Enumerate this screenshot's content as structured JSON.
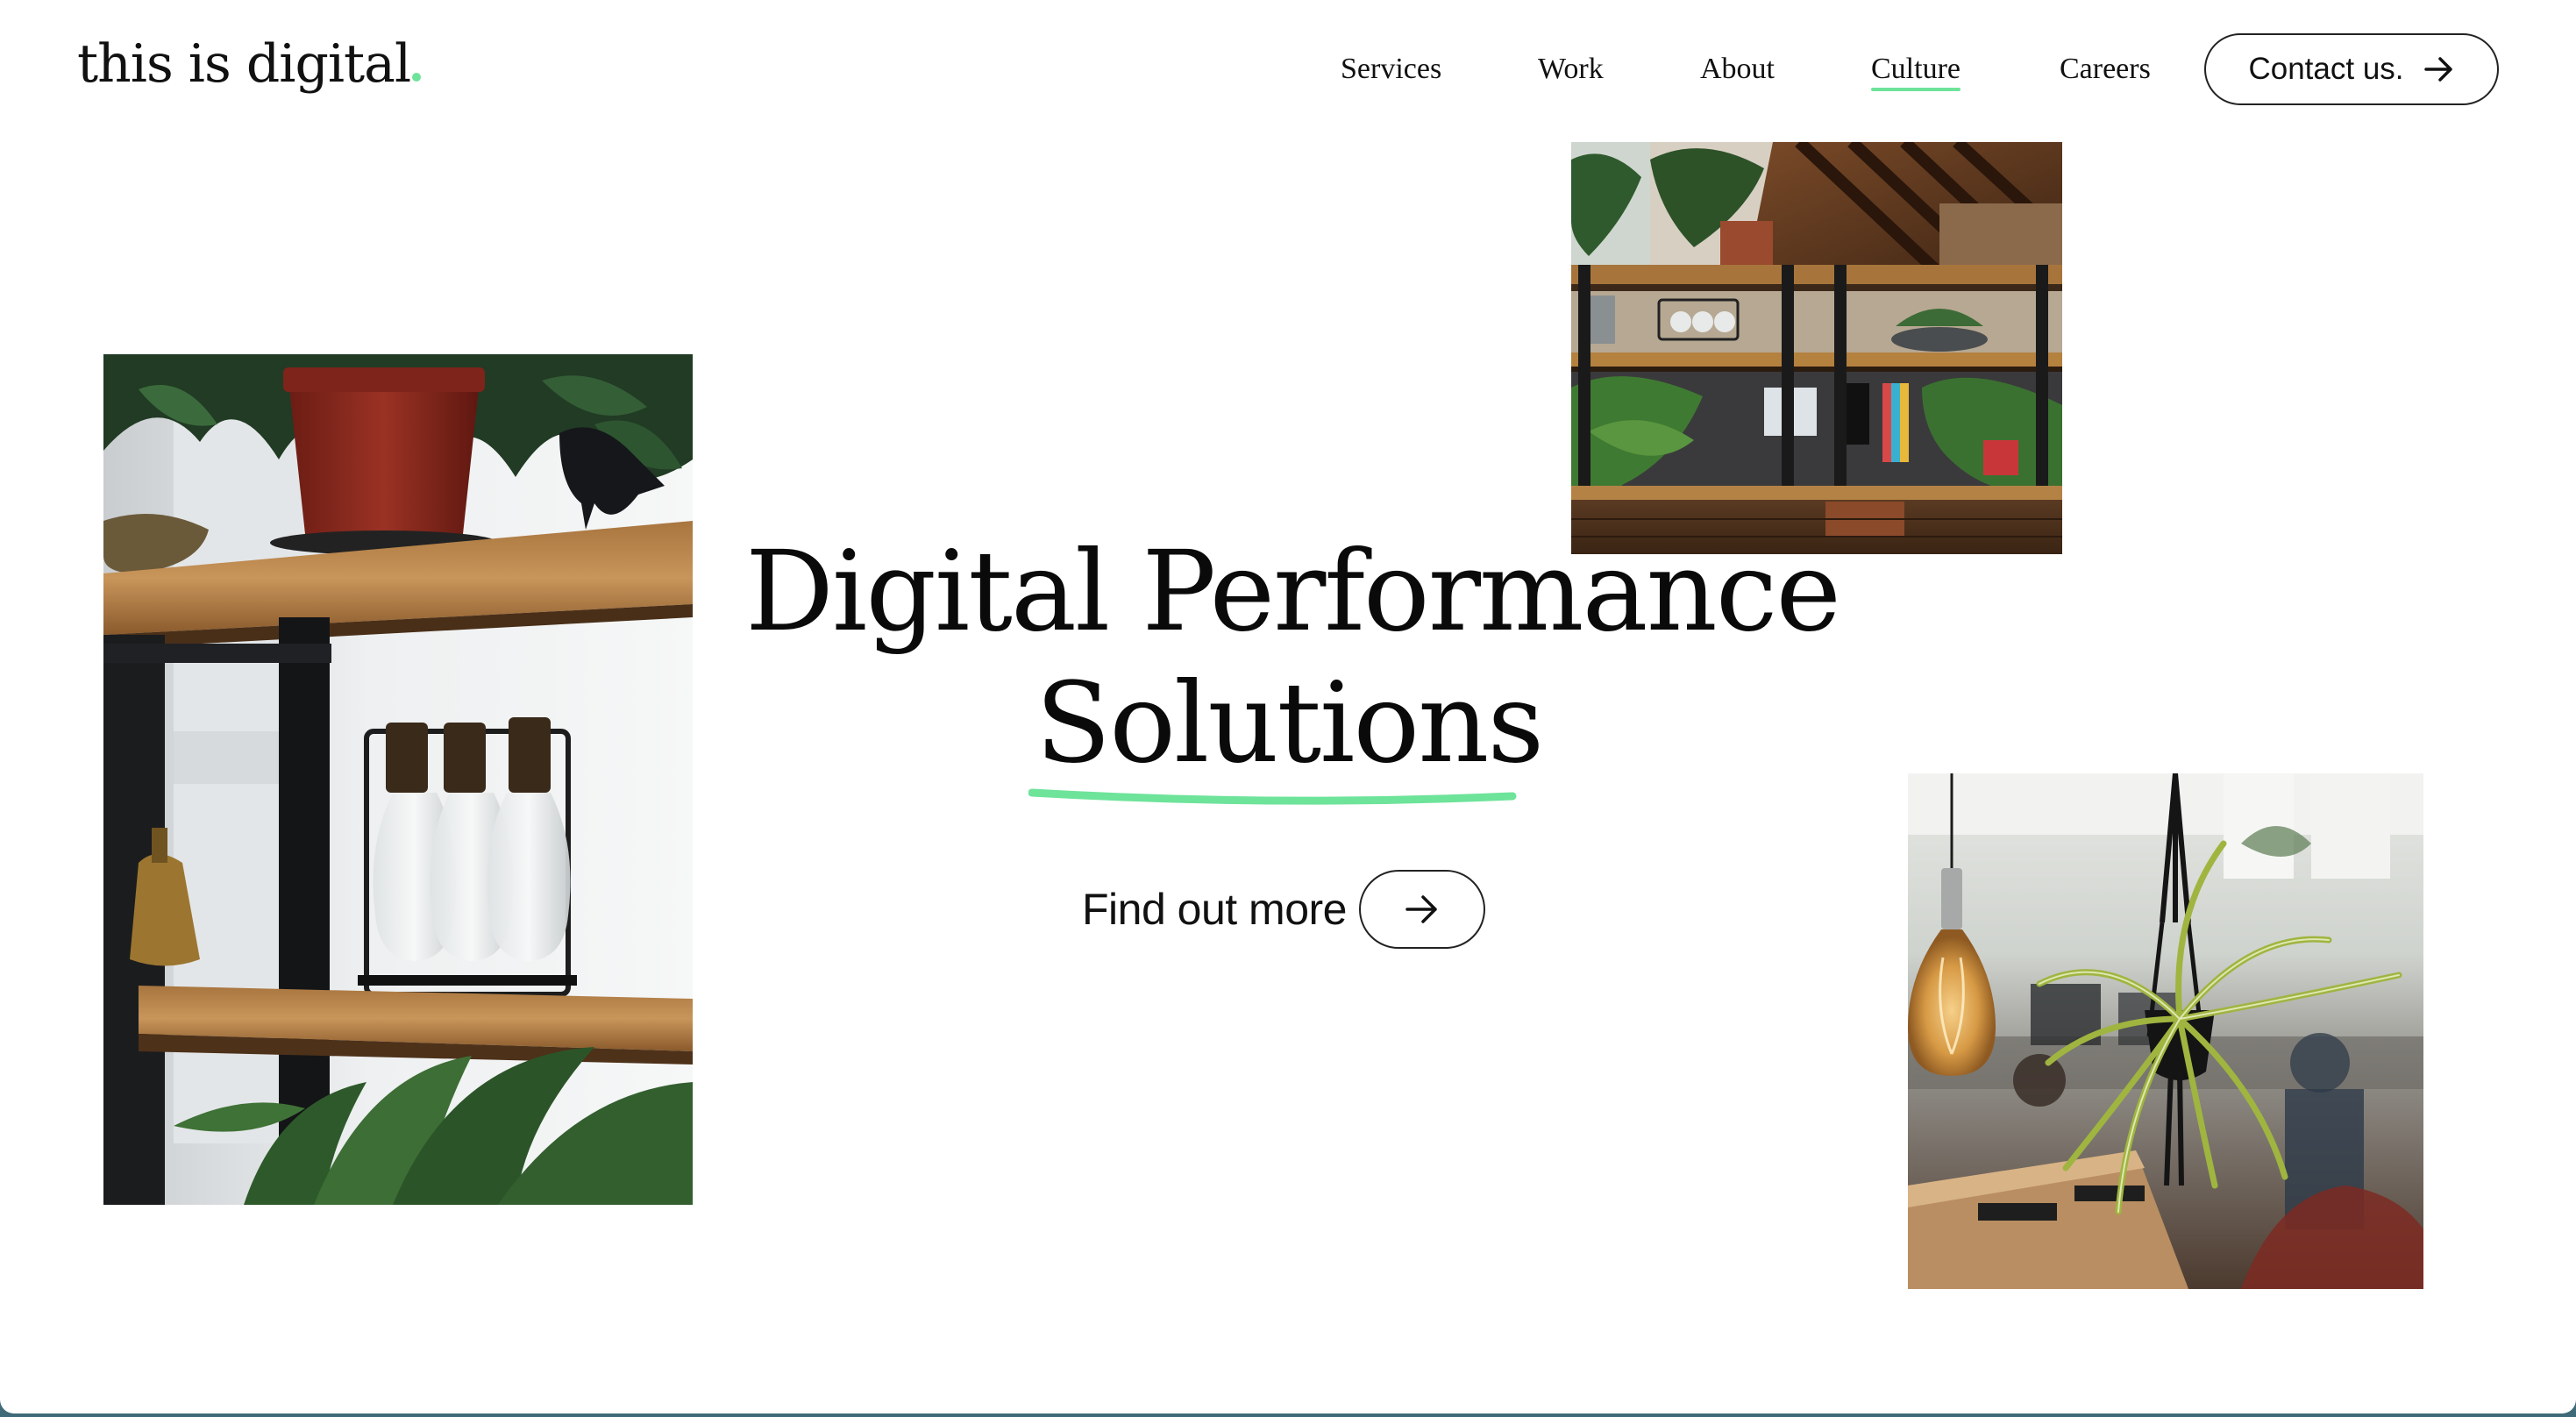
{
  "brand": {
    "logo_text": "this is digital",
    "accent_color": "#6ee39a"
  },
  "nav": {
    "items": [
      {
        "label": "Services",
        "active": false
      },
      {
        "label": "Work",
        "active": false
      },
      {
        "label": "About",
        "active": false
      },
      {
        "label": "Culture",
        "active": true
      },
      {
        "label": "Careers",
        "active": false
      }
    ],
    "contact_label": "Contact us.",
    "contact_icon": "arrow-right-icon"
  },
  "hero": {
    "title_line_1": "Digital Performance",
    "title_line_2": "Solutions",
    "cta_label": "Find out more",
    "cta_icon": "arrow-right-icon"
  },
  "images": [
    {
      "name": "shelf-plants-photo",
      "content": "wooden shelves with potted plant and glass bottles"
    },
    {
      "name": "office-shelving-photo",
      "content": "office interior with plant shelving"
    },
    {
      "name": "hanging-plant-photo",
      "content": "hanging spider plant and filament bulb in office"
    }
  ]
}
